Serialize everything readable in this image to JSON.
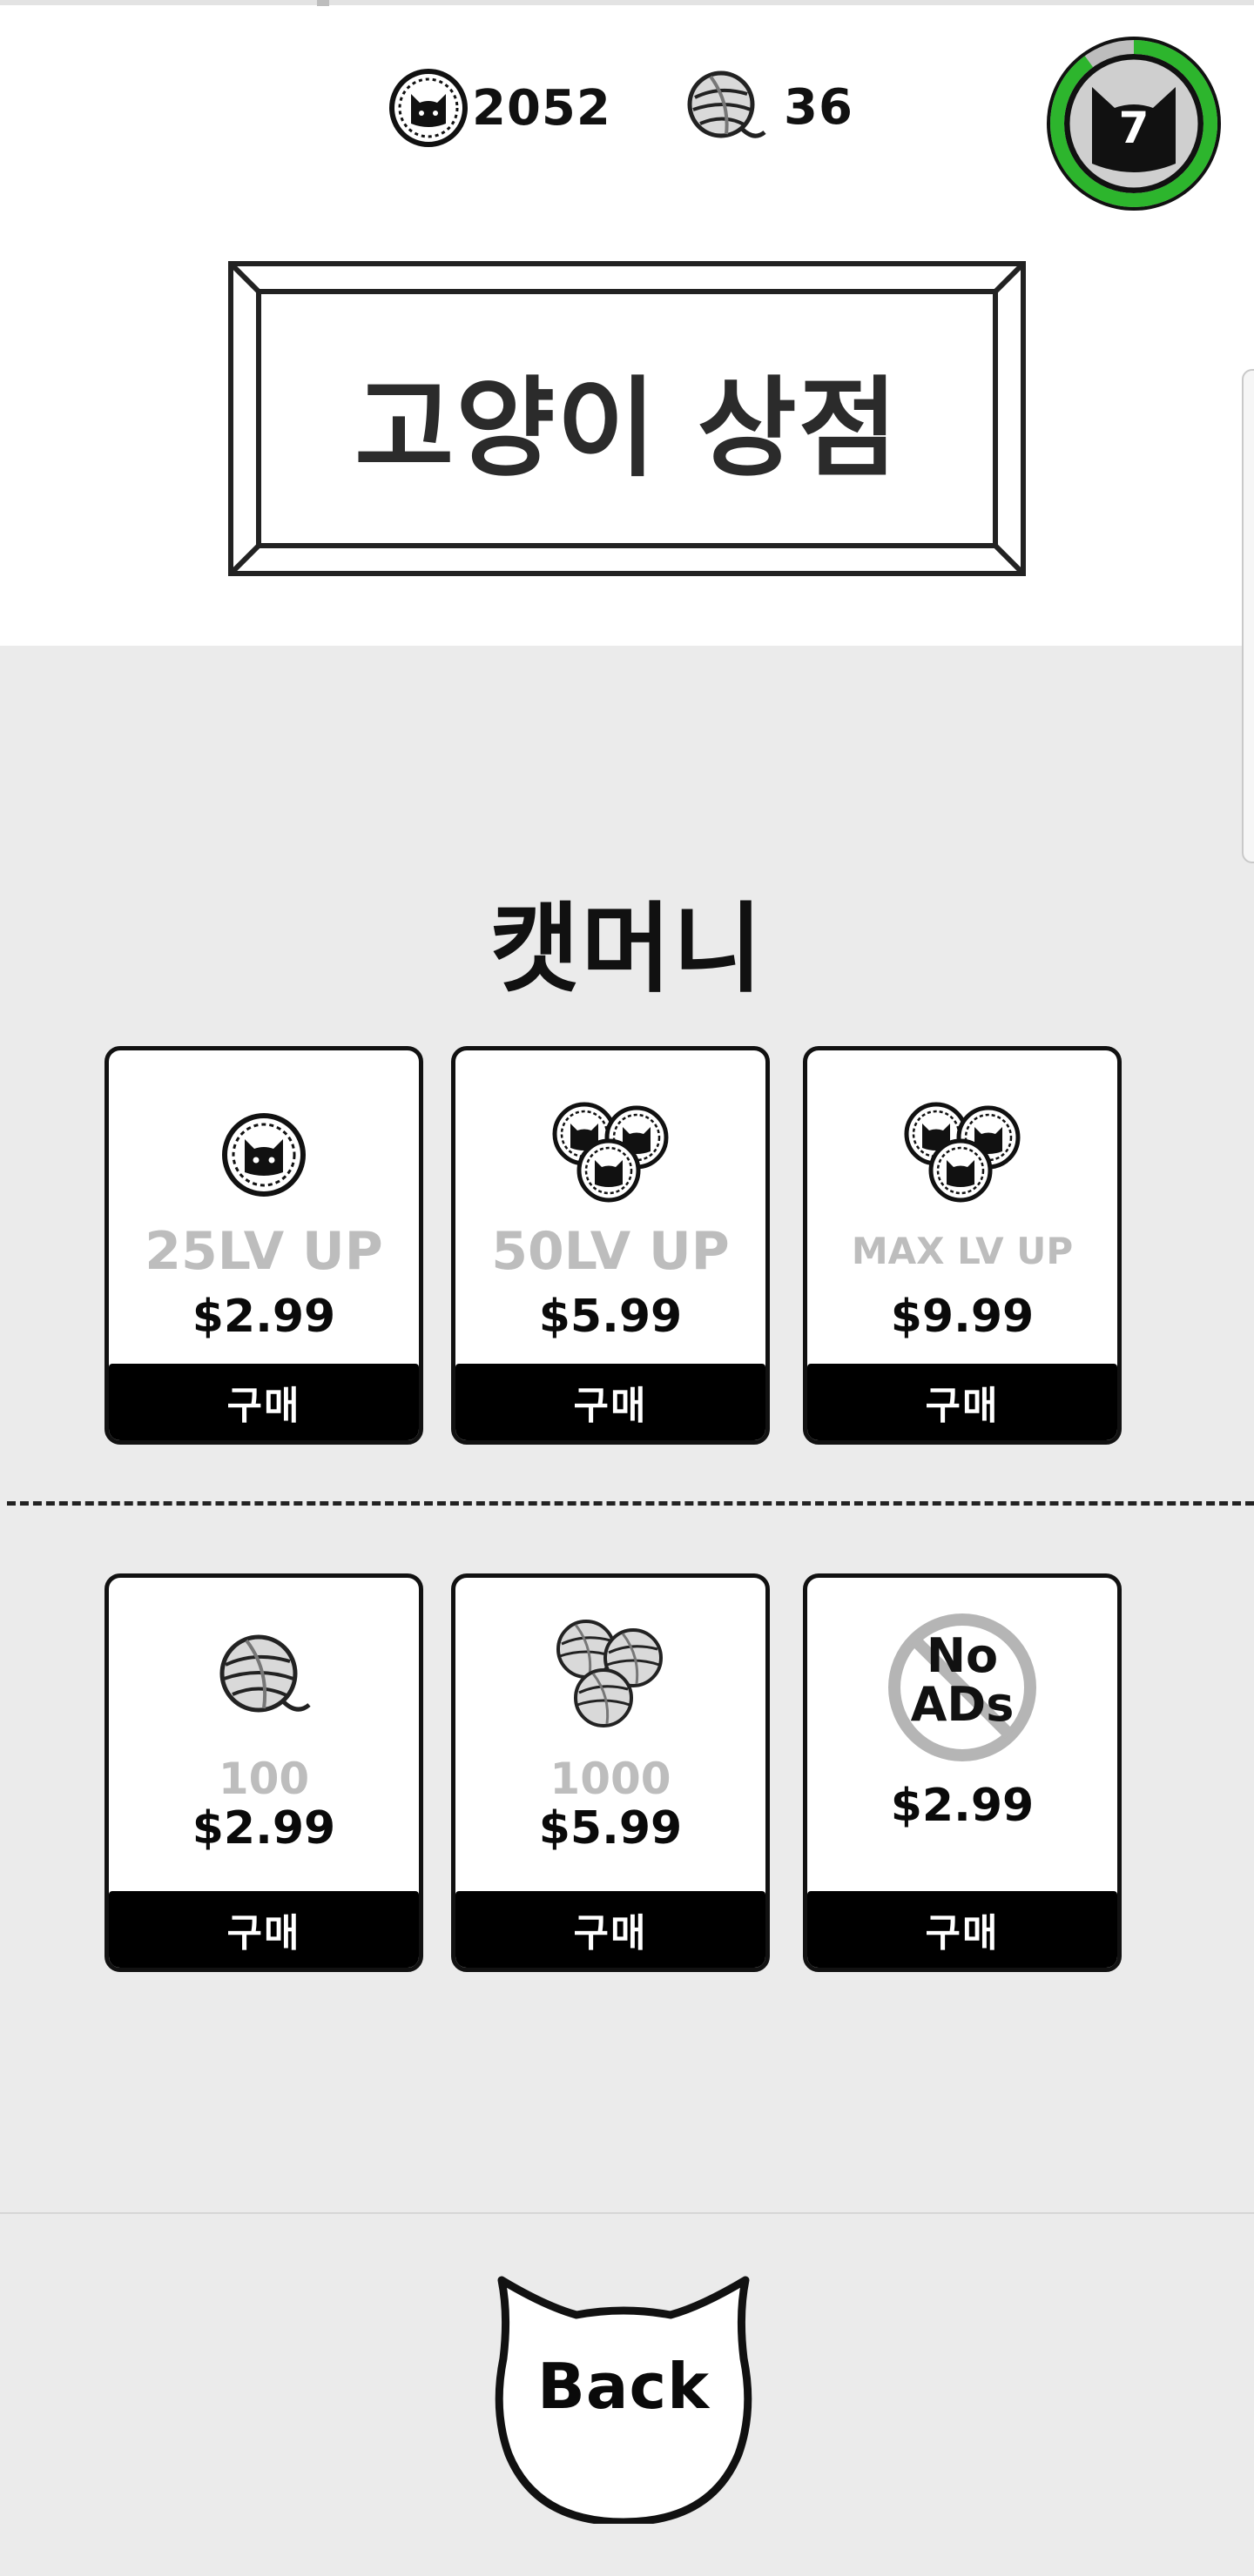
{
  "header": {
    "coins": "2052",
    "yarn": "36",
    "level": "7",
    "coin_icon": "cat-coin-icon",
    "yarn_icon": "yarn-ball-icon",
    "level_progress": 0.9,
    "level_ring_color": "#2db52d"
  },
  "title": "고양이 상점",
  "section": {
    "title": "캣머니"
  },
  "coin_products": [
    {
      "icon": "cat-coin-icon",
      "label": "25LV UP",
      "price": "$2.99",
      "buy": "구매"
    },
    {
      "icon": "cat-coins-stack-icon",
      "label": "50LV UP",
      "price": "$5.99",
      "buy": "구매"
    },
    {
      "icon": "cat-coins-stack-icon",
      "label": "MAX LV UP",
      "price": "$9.99",
      "buy": "구매"
    }
  ],
  "yarn_products": [
    {
      "icon": "yarn-ball-icon",
      "label": "100",
      "price": "$2.99",
      "buy": "구매"
    },
    {
      "icon": "yarn-balls-stack-icon",
      "label": "1000",
      "price": "$5.99",
      "buy": "구매"
    },
    {
      "icon": "no-ads-icon",
      "no_ads_line1": "No",
      "no_ads_line2": "ADs",
      "price": "$2.99",
      "buy": "구매"
    }
  ],
  "back_button": {
    "label": "Back",
    "icon": "cat-head-icon"
  },
  "colors": {
    "background_gray": "#ebebeb",
    "label_gray": "#bdbdbd",
    "level_ring": "#2db52d"
  }
}
